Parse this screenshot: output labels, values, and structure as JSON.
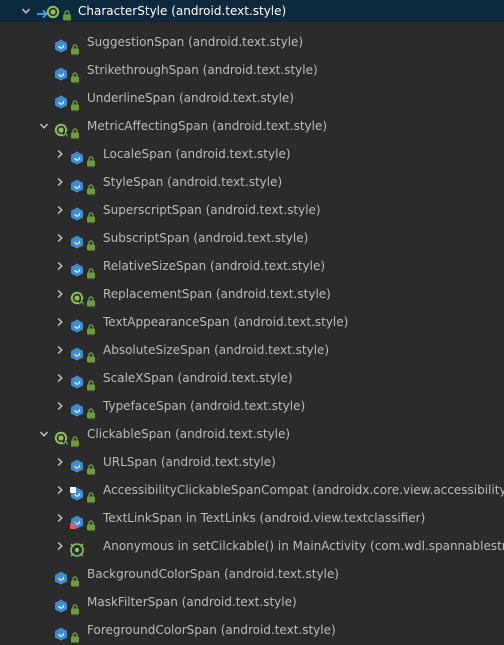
{
  "tree": {
    "root": {
      "name": "CharacterStyle",
      "package": "(android.text.style)"
    },
    "items": [
      {
        "name": "SuggestionSpan",
        "package": "(android.text.style)"
      },
      {
        "name": "StrikethroughSpan",
        "package": "(android.text.style)"
      },
      {
        "name": "UnderlineSpan",
        "package": "(android.text.style)"
      },
      {
        "name": "MetricAffectingSpan",
        "package": "(android.text.style)"
      },
      {
        "name": "LocaleSpan",
        "package": "(android.text.style)"
      },
      {
        "name": "StyleSpan",
        "package": "(android.text.style)"
      },
      {
        "name": "SuperscriptSpan",
        "package": "(android.text.style)"
      },
      {
        "name": "SubscriptSpan",
        "package": "(android.text.style)"
      },
      {
        "name": "RelativeSizeSpan",
        "package": "(android.text.style)"
      },
      {
        "name": "ReplacementSpan",
        "package": "(android.text.style)"
      },
      {
        "name": "TextAppearanceSpan",
        "package": "(android.text.style)"
      },
      {
        "name": "AbsoluteSizeSpan",
        "package": "(android.text.style)"
      },
      {
        "name": "ScaleXSpan",
        "package": "(android.text.style)"
      },
      {
        "name": "TypefaceSpan",
        "package": "(android.text.style)"
      },
      {
        "name": "ClickableSpan",
        "package": "(android.text.style)"
      },
      {
        "name": "URLSpan",
        "package": "(android.text.style)"
      },
      {
        "name": "AccessibilityClickableSpanCompat",
        "package": "(androidx.core.view.accessibility)"
      },
      {
        "name": "TextLinkSpan in TextLinks",
        "package": "(android.view.textclassifier)"
      },
      {
        "name": "Anonymous in setCilckable() in MainActivity",
        "package": "(com.wdl.spannablestring)"
      },
      {
        "name": "BackgroundColorSpan",
        "package": "(android.text.style)"
      },
      {
        "name": "MaskFilterSpan",
        "package": "(android.text.style)"
      },
      {
        "name": "ForegroundColorSpan",
        "package": "(android.text.style)"
      }
    ]
  },
  "colors": {
    "background": "#2b2b2b",
    "selected_row": "#0d293e",
    "text": "#bbbbbb",
    "class_icon": "#3d8fd1",
    "abstract_icon": "#8fbf5a",
    "lock": "#6a9d3a"
  }
}
